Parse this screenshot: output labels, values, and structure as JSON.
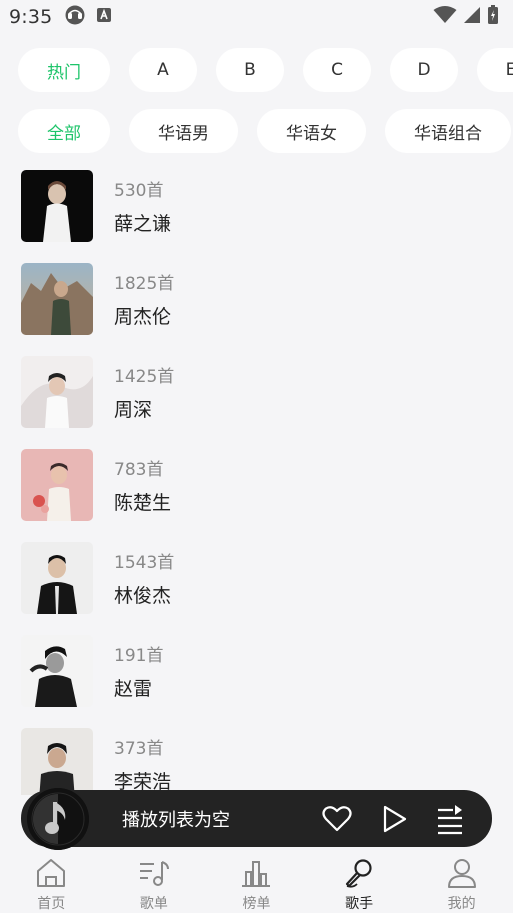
{
  "status_bar": {
    "time": "9:35",
    "left_icons": [
      "headset-icon",
      "a-box-icon"
    ],
    "right_icons": [
      "wifi-icon",
      "signal-icon",
      "battery-icon"
    ]
  },
  "filters": {
    "row1": [
      {
        "label": "热门",
        "active": true
      },
      {
        "label": "A",
        "active": false
      },
      {
        "label": "B",
        "active": false
      },
      {
        "label": "C",
        "active": false
      },
      {
        "label": "D",
        "active": false
      },
      {
        "label": "E",
        "active": false
      }
    ],
    "row2": [
      {
        "label": "全部",
        "active": true
      },
      {
        "label": "华语男",
        "active": false
      },
      {
        "label": "华语女",
        "active": false
      },
      {
        "label": "华语组合",
        "active": false
      }
    ]
  },
  "singers": [
    {
      "count": "530首",
      "name": "薛之谦"
    },
    {
      "count": "1825首",
      "name": "周杰伦"
    },
    {
      "count": "1425首",
      "name": "周深"
    },
    {
      "count": "783首",
      "name": "陈楚生"
    },
    {
      "count": "1543首",
      "name": "林俊杰"
    },
    {
      "count": "191首",
      "name": "赵雷"
    },
    {
      "count": "373首",
      "name": "李荣浩"
    }
  ],
  "player": {
    "title": "播放列表为空",
    "icons": [
      "music-note-icon",
      "heart-icon",
      "play-icon",
      "playlist-icon"
    ]
  },
  "nav": [
    {
      "label": "首页",
      "icon": "home-icon",
      "active": false
    },
    {
      "label": "歌单",
      "icon": "playlist-note-icon",
      "active": false
    },
    {
      "label": "榜单",
      "icon": "bar-chart-icon",
      "active": false
    },
    {
      "label": "歌手",
      "icon": "microphone-icon",
      "active": true
    },
    {
      "label": "我的",
      "icon": "user-icon",
      "active": false
    }
  ],
  "colors": {
    "accent": "#1ec46a",
    "background": "#f5f5f7",
    "player_bg": "#232323"
  }
}
